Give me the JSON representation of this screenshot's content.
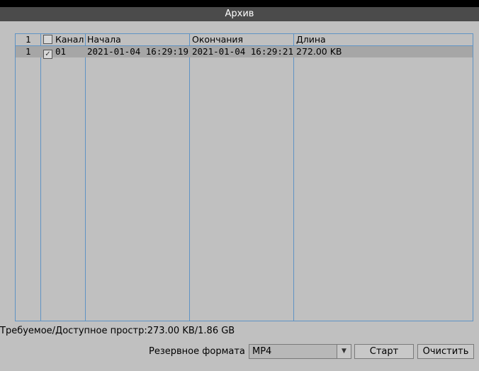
{
  "window": {
    "title": "Архив"
  },
  "table": {
    "header": {
      "index": "1",
      "channel": "Канал",
      "start": "Начала",
      "end": "Окончания",
      "length": "Длина"
    },
    "rows": [
      {
        "index": "1",
        "checked": true,
        "channel": "01",
        "start": "2021-01-04 16:29:19",
        "end": "2021-01-04 16:29:21",
        "length": "272.00 KB"
      }
    ]
  },
  "space_info": "Требуемое/Доступное простр:273.00 KB/1.86 GB",
  "format": {
    "label": "Резервное формата",
    "value": "MP4"
  },
  "buttons": {
    "start": "Старт",
    "clear": "Очистить"
  },
  "icons": {
    "checkbox_checked": "checkmark-icon",
    "dropdown": "triangle-down-icon"
  }
}
